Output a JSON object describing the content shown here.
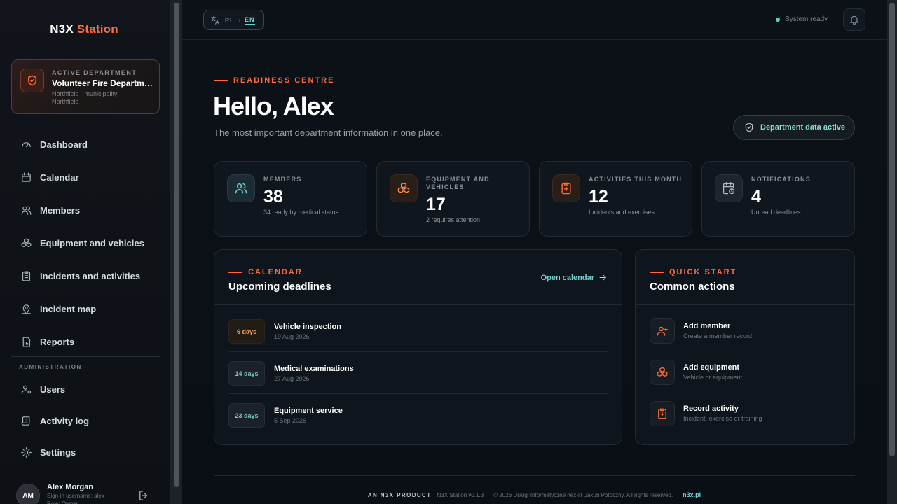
{
  "brand": {
    "name_a": "N3X",
    "name_b": "Station"
  },
  "department": {
    "kicker": "ACTIVE DEPARTMENT",
    "name": "Volunteer Fire Department Northfield",
    "sub1": "Northfield · municipality",
    "sub2": "Northfield"
  },
  "nav": {
    "dashboard": "Dashboard",
    "calendar": "Calendar",
    "members": "Members",
    "equipment": "Equipment and vehicles",
    "incidents": "Incidents and activities",
    "map": "Incident map",
    "reports": "Reports",
    "admin_label": "ADMINISTRATION",
    "users": "Users",
    "activity_log": "Activity log",
    "settings": "Settings"
  },
  "user": {
    "initials": "AM",
    "name": "Alex Morgan",
    "signin": "Sign-in username: alex",
    "role": "Role: Owner"
  },
  "topbar": {
    "lang_pl": "PL",
    "lang_sep": "/",
    "lang_en": "EN",
    "status": "System ready"
  },
  "hero": {
    "kicker": "READINESS CENTRE",
    "title": "Hello, Alex",
    "subtitle": "The most important department information in one place.",
    "badge": "Department data active"
  },
  "stats": [
    {
      "label": "MEMBERS",
      "value": "38",
      "sub": "34 ready by medical status"
    },
    {
      "label": "EQUIPMENT AND VEHICLES",
      "value": "17",
      "sub": "2 requires attention"
    },
    {
      "label": "ACTIVITIES THIS MONTH",
      "value": "12",
      "sub": "Incidents and exercises"
    },
    {
      "label": "NOTIFICATIONS",
      "value": "4",
      "sub": "Unread deadlines"
    }
  ],
  "calendar": {
    "kicker": "CALENDAR",
    "title": "Upcoming deadlines",
    "open_label": "Open calendar",
    "items": [
      {
        "days": "6 days",
        "name": "Vehicle inspection",
        "date": "19 Aug 2026"
      },
      {
        "days": "14 days",
        "name": "Medical examinations",
        "date": "27 Aug 2026"
      },
      {
        "days": "23 days",
        "name": "Equipment service",
        "date": "5 Sep 2026"
      }
    ]
  },
  "quick": {
    "kicker": "QUICK START",
    "title": "Common actions",
    "items": [
      {
        "name": "Add member",
        "desc": "Create a member record"
      },
      {
        "name": "Add equipment",
        "desc": "Vehicle or equipment"
      },
      {
        "name": "Record activity",
        "desc": "Incident, exercise or training"
      }
    ]
  },
  "footer": {
    "brand": "AN N3X PRODUCT",
    "version": "N3X Station v0.1.3",
    "copyright": "© 2026 Usługi Informatyczne nex-IT Jakub Potoczny. All rights reserved.",
    "link": "n3x.pl"
  },
  "colors": {
    "accent": "#ff6a3d",
    "teal": "#6fd3d0",
    "background": "#0b1017"
  }
}
